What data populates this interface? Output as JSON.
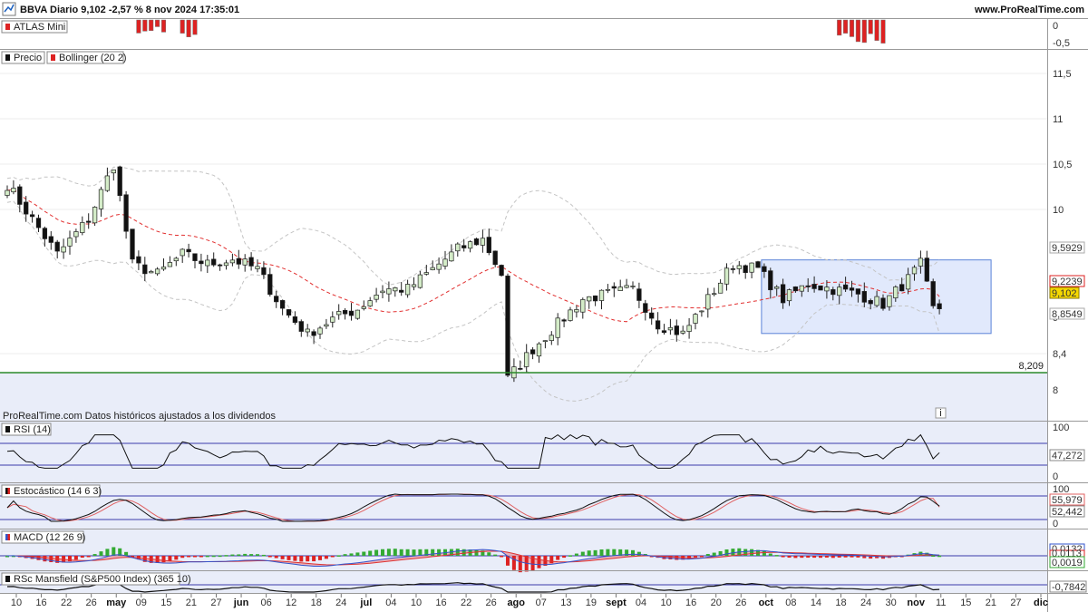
{
  "header": {
    "title": "BBVA Diario 9,102 -2,57 % 8 nov 2024 17:35:01",
    "brand": "www.ProRealTime.com"
  },
  "colors": {
    "panel_bg": "#e9edf9",
    "up_candle": "#d4ecc8",
    "down_candle": "#111111",
    "middle_band": "#e23030",
    "outer_band": "#c4c4c4",
    "support": "#2a8a2a",
    "rect": "#5b83d8",
    "macd_hist_pos": "#33aa33",
    "macd_hist_neg": "#dd2222"
  },
  "panels": {
    "atlas": {
      "label": "ATLAS Mini",
      "ticks": [
        "0",
        "-0,5"
      ]
    },
    "price": {
      "labels": [
        "Precio",
        "Bollinger (20 2)"
      ],
      "footnote": "ProRealTime.com  Datos históricos ajustados a los dividendos",
      "info_icon_text": "i",
      "ticks": [
        "11,5",
        "11",
        "10,5",
        "10",
        "9",
        "8,4",
        "8"
      ],
      "support_label": "8,209",
      "badges": {
        "upper": "9,5929",
        "middle": "9,2239",
        "last": "9,102",
        "lower": "8,8549"
      }
    },
    "rsi": {
      "label": "RSI (14)",
      "ticks": [
        "100",
        "0"
      ],
      "badge": "47,272"
    },
    "stoch": {
      "label": "Estocástico (14 6 3)",
      "ticks": [
        "100",
        "0"
      ],
      "badges": [
        "55,979",
        "52,442"
      ]
    },
    "macd": {
      "label": "MACD (12 26 9)",
      "badges": [
        "0,0132",
        "0,0113",
        "0,0019"
      ]
    },
    "mansfield": {
      "label": "RSc Mansfield (S&P500 Index) (365 10)",
      "badge": "-0,7842"
    }
  },
  "chart_data": {
    "type": "candlestick",
    "title": "BBVA Diario 9,102 -2,57 % 8 nov 2024 17:35:01",
    "x_labels": [
      {
        "text": "10",
        "bold": false
      },
      {
        "text": "16",
        "bold": false
      },
      {
        "text": "22",
        "bold": false
      },
      {
        "text": "26",
        "bold": false
      },
      {
        "text": "may",
        "bold": true
      },
      {
        "text": "09",
        "bold": false
      },
      {
        "text": "15",
        "bold": false
      },
      {
        "text": "21",
        "bold": false
      },
      {
        "text": "27",
        "bold": false
      },
      {
        "text": "jun",
        "bold": true
      },
      {
        "text": "06",
        "bold": false
      },
      {
        "text": "12",
        "bold": false
      },
      {
        "text": "18",
        "bold": false
      },
      {
        "text": "24",
        "bold": false
      },
      {
        "text": "jul",
        "bold": true
      },
      {
        "text": "04",
        "bold": false
      },
      {
        "text": "10",
        "bold": false
      },
      {
        "text": "16",
        "bold": false
      },
      {
        "text": "22",
        "bold": false
      },
      {
        "text": "26",
        "bold": false
      },
      {
        "text": "ago",
        "bold": true
      },
      {
        "text": "07",
        "bold": false
      },
      {
        "text": "13",
        "bold": false
      },
      {
        "text": "19",
        "bold": false
      },
      {
        "text": "sept",
        "bold": true
      },
      {
        "text": "04",
        "bold": false
      },
      {
        "text": "10",
        "bold": false
      },
      {
        "text": "16",
        "bold": false
      },
      {
        "text": "20",
        "bold": false
      },
      {
        "text": "26",
        "bold": false
      },
      {
        "text": "oct",
        "bold": true
      },
      {
        "text": "08",
        "bold": false
      },
      {
        "text": "14",
        "bold": false
      },
      {
        "text": "18",
        "bold": false
      },
      {
        "text": "24",
        "bold": false
      },
      {
        "text": "30",
        "bold": false
      },
      {
        "text": "nov",
        "bold": true
      },
      {
        "text": "11",
        "bold": false
      },
      {
        "text": "15",
        "bold": false
      },
      {
        "text": "21",
        "bold": false
      },
      {
        "text": "27",
        "bold": false
      },
      {
        "text": "dic",
        "bold": true
      }
    ],
    "price_anchors": [
      [
        0,
        10.35
      ],
      [
        4,
        10.0
      ],
      [
        8,
        9.65
      ],
      [
        13,
        10.0
      ],
      [
        17,
        10.55
      ],
      [
        20,
        9.55
      ],
      [
        24,
        9.45
      ],
      [
        28,
        9.65
      ],
      [
        32,
        9.55
      ],
      [
        36,
        9.6
      ],
      [
        40,
        9.5
      ],
      [
        44,
        9.1
      ],
      [
        48,
        8.85
      ],
      [
        52,
        9.0
      ],
      [
        56,
        9.1
      ],
      [
        60,
        9.3
      ],
      [
        64,
        9.3
      ],
      [
        68,
        9.5
      ],
      [
        72,
        9.7
      ],
      [
        76,
        9.8
      ],
      [
        79,
        9.45
      ],
      [
        80,
        8.4
      ],
      [
        84,
        8.7
      ],
      [
        88,
        8.95
      ],
      [
        92,
        9.2
      ],
      [
        96,
        9.25
      ],
      [
        100,
        9.3
      ],
      [
        104,
        8.95
      ],
      [
        108,
        8.85
      ],
      [
        112,
        9.2
      ],
      [
        116,
        9.55
      ],
      [
        120,
        9.5
      ],
      [
        124,
        9.2
      ],
      [
        128,
        9.35
      ],
      [
        132,
        9.3
      ],
      [
        136,
        9.25
      ],
      [
        140,
        9.15
      ],
      [
        144,
        9.4
      ],
      [
        146,
        9.55
      ],
      [
        148,
        9.1
      ],
      [
        149,
        9.102
      ]
    ],
    "ylim": [
      7.98,
      11.7
    ],
    "support_level": 8.209,
    "last_value": 9.102,
    "bollinger_last": {
      "upper": 9.5929,
      "middle": 9.2239,
      "lower": 8.8549
    },
    "consolidation_box": {
      "bar_start": 121,
      "bar_end": 149,
      "high": 9.5929,
      "low": 8.8549
    },
    "atlas_bars": [
      21,
      22,
      23,
      24,
      25,
      28,
      29,
      30,
      133,
      134,
      135,
      136,
      137,
      138,
      139,
      140
    ],
    "rsi": {
      "ylim": [
        0,
        100
      ],
      "overbought": 70,
      "oversold": 30,
      "last": 47.272
    },
    "stochastic": {
      "ylim": [
        0,
        100
      ],
      "k_last": 55.979,
      "d_last": 52.442
    },
    "macd": {
      "last": 0.0132,
      "signal": 0.0113,
      "hist": 0.0019
    },
    "mansfield": {
      "last": -0.7842
    }
  }
}
